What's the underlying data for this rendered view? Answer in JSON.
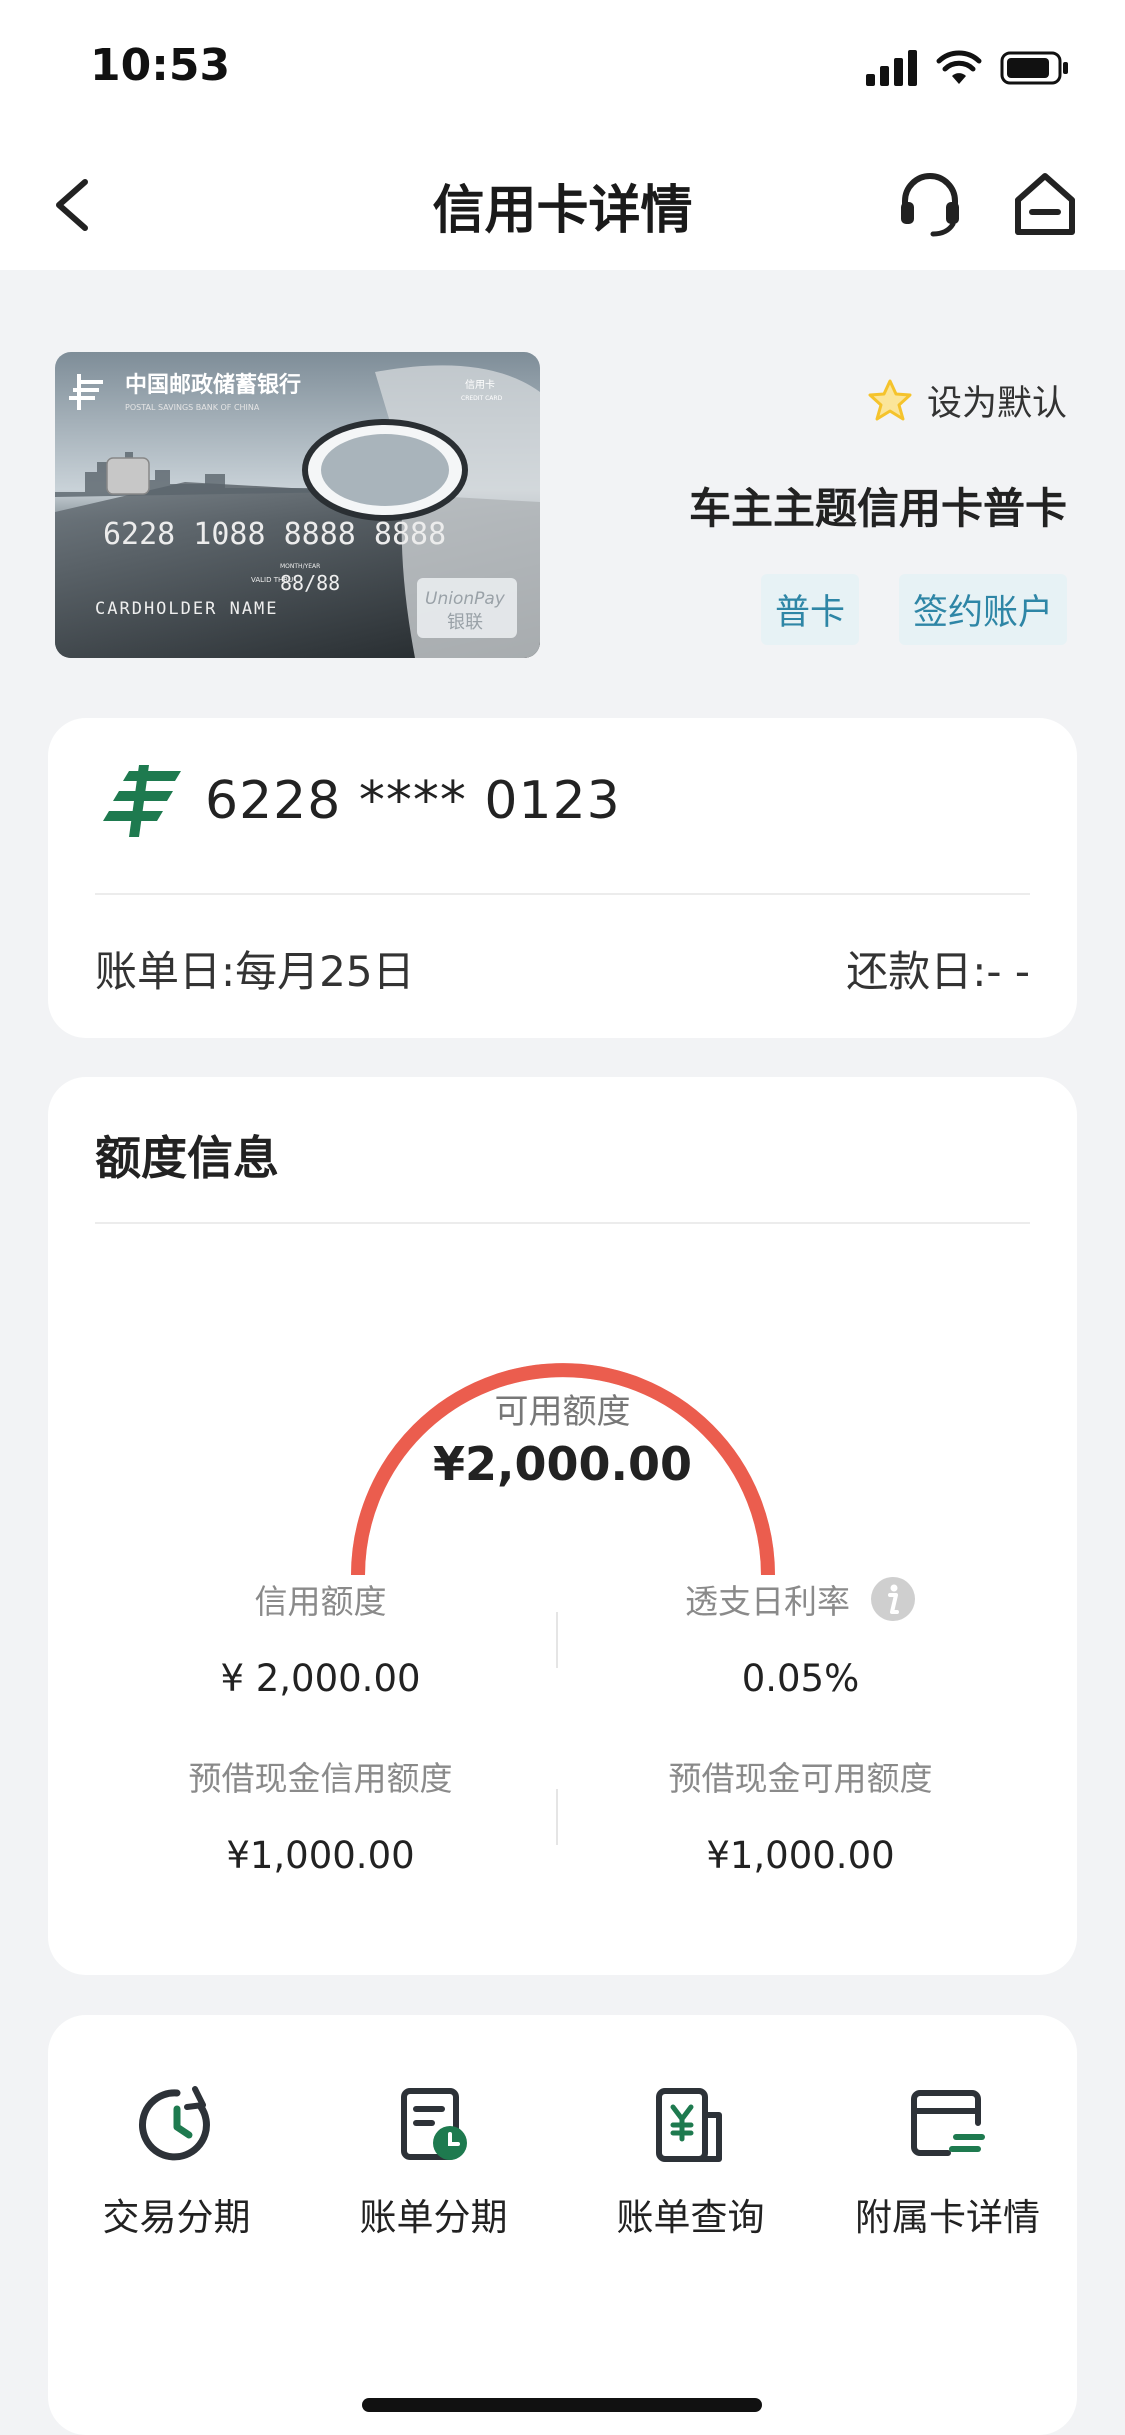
{
  "status_bar": {
    "time": "10:53"
  },
  "nav": {
    "title": "信用卡详情"
  },
  "card": {
    "bank_name_cn": "中国邮政储蓄银行",
    "bank_name_en": "POSTAL SAVINGS BANK OF CHINA",
    "card_label_cn": "信用卡",
    "card_label_en": "CREDIT CARD",
    "card_number_print": "6228  1088  8888  8888",
    "valid_label": "VALID THRU",
    "month_year_label": "MONTH/YEAR",
    "valid_date": "88/88",
    "holder": "CARDHOLDER  NAME",
    "unionpay": "UnionPay",
    "unionpay_cn": "银联",
    "set_default": "设为默认",
    "name": "车主主题信用卡普卡",
    "tags": [
      "普卡",
      "签约账户"
    ]
  },
  "account": {
    "number": "6228 **** 0123",
    "bill_day": "账单日:每月25日",
    "pay_day": "还款日:- -"
  },
  "limit": {
    "title": "额度信息",
    "available_label": "可用额度",
    "available_value": "¥2,000.00",
    "available_ratio": 1.0,
    "items": [
      {
        "label": "信用额度",
        "value": "¥ 2,000.00"
      },
      {
        "label": "透支日利率",
        "value": "0.05%"
      },
      {
        "label": "预借现金信用额度",
        "value": "¥1,000.00"
      },
      {
        "label": "预借现金可用额度",
        "value": "¥1,000.00"
      }
    ]
  },
  "quick_actions": [
    {
      "label": "交易分期",
      "icon": "clock-installment-icon"
    },
    {
      "label": "账单分期",
      "icon": "bill-clock-icon"
    },
    {
      "label": "账单查询",
      "icon": "bill-yuan-icon"
    },
    {
      "label": "附属卡详情",
      "icon": "card-detail-icon"
    }
  ],
  "colors": {
    "accent_green": "#1e7a4f",
    "gauge_red": "#eb5d4e",
    "tag_blue": "#2e86a6",
    "star_yellow": "#f5c32c"
  }
}
